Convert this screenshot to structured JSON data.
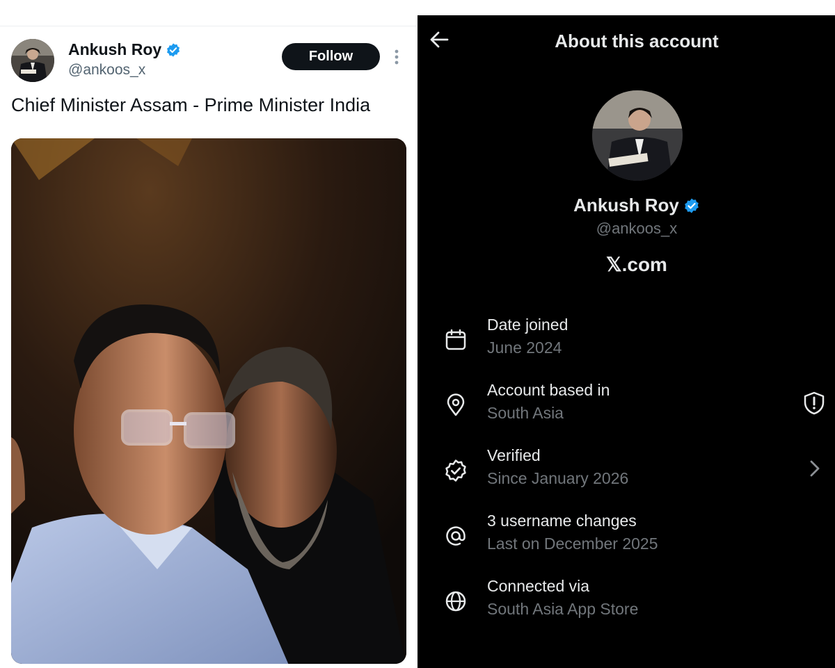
{
  "tweet": {
    "author_name": "Ankush Roy",
    "author_handle": "@ankoos_x",
    "follow_label": "Follow",
    "text": "Chief Minister Assam - Prime Minister India"
  },
  "about": {
    "title": "About this account",
    "name": "Ankush Roy",
    "handle": "@ankoos_x",
    "site": "𝕏.com",
    "rows": [
      {
        "label": "Date joined",
        "value": "June 2024",
        "icon": "calendar-icon"
      },
      {
        "label": "Account based in",
        "value": "South Asia",
        "icon": "location-pin-icon",
        "trailing": "shield-alert-icon"
      },
      {
        "label": "Verified",
        "value": "Since January 2026",
        "icon": "verified-badge-icon",
        "trailing": "chevron-right-icon"
      },
      {
        "label": "3 username changes",
        "value": "Last on December 2025",
        "icon": "at-sign-icon"
      },
      {
        "label": "Connected via",
        "value": "South Asia App Store",
        "icon": "globe-icon"
      }
    ]
  },
  "colors": {
    "verified_blue": "#1d9bf0",
    "text_dark": "#0f1419",
    "muted_gray": "#536471",
    "dark_bg": "#000000",
    "muted_dark": "#71767b"
  }
}
